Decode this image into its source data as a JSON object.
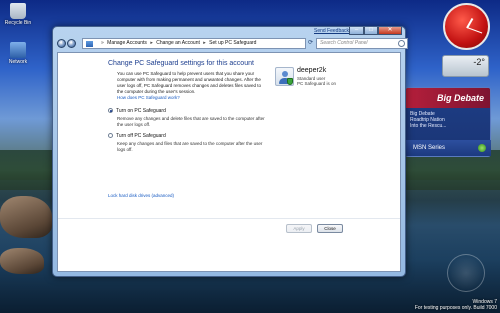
{
  "desktop": {
    "icons": [
      {
        "label": "Recycle Bin",
        "icon": "recycle-bin-icon"
      },
      {
        "label": "Network",
        "icon": "network-icon"
      }
    ],
    "watermark": {
      "line1": "Windows 7",
      "line2": "For testing purposes only. Build 7000"
    }
  },
  "gadgets": {
    "weather": {
      "temp": "-2°"
    },
    "feed": {
      "title": "Big Debate",
      "line1": "Big Debate",
      "line2": "Roadtrip Nation",
      "line3": "Into the Rescu..."
    },
    "msn": {
      "label": "MSN Series"
    }
  },
  "window": {
    "send_feedback": "Send Feedback",
    "breadcrumb": [
      "Manage Accounts",
      "Change an Account",
      "Set up PC Safeguard"
    ],
    "search_placeholder": "Search Control Panel",
    "heading": "Change PC Safeguard settings for this account",
    "intro": "You can use PC Safeguard to help prevent users that you share your computer with from making permanent and unwanted changes. After the user logs off, PC Safeguard removes changes and deletes files saved to the computer during the user's session.",
    "how_link": "How does PC Safeguard work?",
    "user": {
      "name": "deeper2k",
      "role": "Standard user",
      "status": "PC Safeguard is on"
    },
    "options": [
      {
        "label": "Turn on PC Safeguard",
        "desc": "Remove any changes and delete files that are saved to the computer after the user logs off.",
        "selected": true
      },
      {
        "label": "Turn off PC Safeguard",
        "desc": "Keep any changes and files that are saved to the computer after the user logs off.",
        "selected": false
      }
    ],
    "lock_link": "Lock hard disk drives (advanced)",
    "apply_label": "Apply",
    "close_label": "Close"
  }
}
